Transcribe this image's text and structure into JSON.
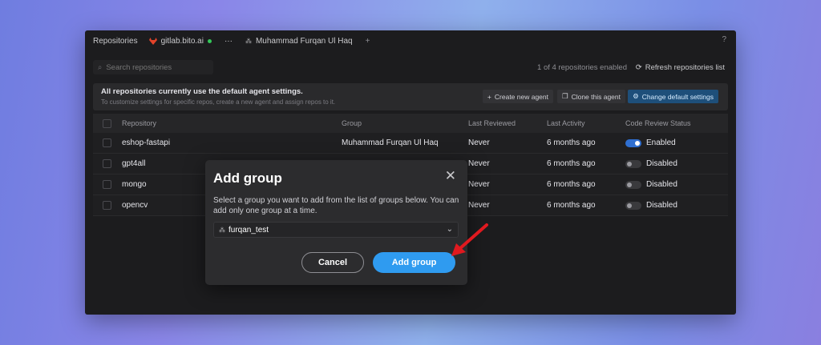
{
  "topbar": {
    "title": "Repositories",
    "host": "gitlab.bito.ai",
    "more": "···",
    "user": "Muhammad Furqan Ul Haq",
    "add_tab": "+",
    "help": "?"
  },
  "search": {
    "placeholder": "Search repositories"
  },
  "status": {
    "count_text": "1 of 4 repositories enabled",
    "refresh_label": "Refresh repositories list"
  },
  "banner": {
    "title": "All repositories currently use the default agent settings.",
    "subtitle": "To customize settings for specific repos, create a new agent and assign repos to it.",
    "create_agent": "Create new agent",
    "clone_agent": "Clone this agent",
    "change_defaults": "Change default settings"
  },
  "table": {
    "headers": {
      "repo": "Repository",
      "group": "Group",
      "last_reviewed": "Last Reviewed",
      "last_activity": "Last Activity",
      "status": "Code Review Status"
    },
    "rows": [
      {
        "repo": "eshop-fastapi",
        "group": "Muhammad Furqan Ul Haq",
        "last_reviewed": "Never",
        "last_activity": "6 months ago",
        "status": "Enabled",
        "enabled": true
      },
      {
        "repo": "gpt4all",
        "group": "",
        "last_reviewed": "Never",
        "last_activity": "6 months ago",
        "status": "Disabled",
        "enabled": false
      },
      {
        "repo": "mongo",
        "group": "",
        "last_reviewed": "Never",
        "last_activity": "6 months ago",
        "status": "Disabled",
        "enabled": false
      },
      {
        "repo": "opencv",
        "group": "",
        "last_reviewed": "Never",
        "last_activity": "6 months ago",
        "status": "Disabled",
        "enabled": false
      }
    ]
  },
  "modal": {
    "title": "Add group",
    "close": "✕",
    "description": "Select a group you want to add from the list of groups below. You can add only one group at a time.",
    "selected_group": "furqan_test",
    "cancel_label": "Cancel",
    "add_label": "Add group"
  },
  "colors": {
    "accent": "#2f9bf0",
    "enabled_toggle": "#2f6fd1",
    "annotation_arrow": "#e0191f"
  }
}
